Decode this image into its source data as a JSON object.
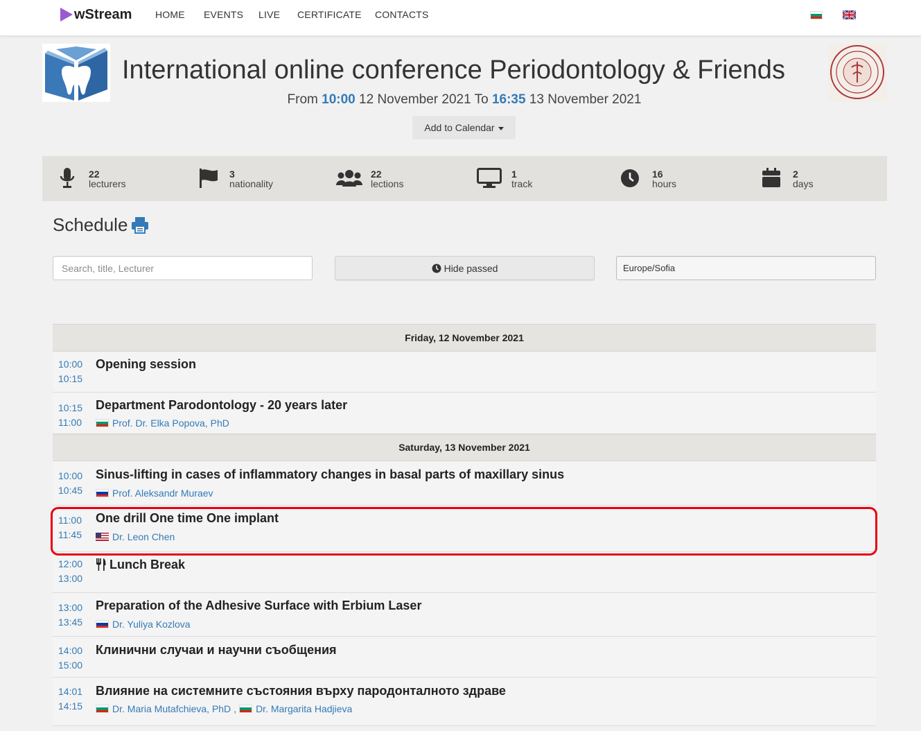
{
  "brand": "wStream",
  "nav": {
    "items": [
      "HOME",
      "EVENTS",
      "LIVE",
      "CERTIFICATE",
      "CONTACTS"
    ]
  },
  "header": {
    "title": "International online conference Periodontology & Friends",
    "from_label": "From",
    "from_time": "10:00",
    "from_date": "12 November 2021",
    "to_label": "To",
    "to_time": "16:35",
    "to_date": "13 November 2021",
    "add_to_calendar": "Add to Calendar"
  },
  "stats": [
    {
      "icon": "microphone-icon",
      "num": "22",
      "label": "lecturers"
    },
    {
      "icon": "flag-icon",
      "num": "3",
      "label": "nationality"
    },
    {
      "icon": "users-icon",
      "num": "22",
      "label": "lections"
    },
    {
      "icon": "monitor-icon",
      "num": "1",
      "label": "track"
    },
    {
      "icon": "clock-icon",
      "num": "16",
      "label": "hours"
    },
    {
      "icon": "calendar-icon",
      "num": "2",
      "label": "days"
    }
  ],
  "schedule": {
    "title": "Schedule",
    "search_placeholder": "Search, title, Lecturer",
    "hide_passed": "Hide passed",
    "timezone": "Europe/Sofia",
    "days": [
      {
        "label": "Friday, 12 November 2021",
        "events": [
          {
            "start": "10:00",
            "end": "10:15",
            "title": "Opening session",
            "speakers": []
          },
          {
            "start": "10:15",
            "end": "11:00",
            "title": "Department Parodontology - 20 years later",
            "speakers": [
              {
                "flag": "bg",
                "name": "Prof. Dr. Elka Popova, PhD"
              }
            ]
          }
        ]
      },
      {
        "label": "Saturday, 13 November 2021",
        "events": [
          {
            "start": "10:00",
            "end": "10:45",
            "title": "Sinus-lifting in cases of inflammatory changes in basal parts of maxillary sinus",
            "speakers": [
              {
                "flag": "ru",
                "name": "Prof. Aleksandr Muraev"
              }
            ]
          },
          {
            "start": "11:00",
            "end": "11:45",
            "title": "One drill One time One implant",
            "speakers": [
              {
                "flag": "us",
                "name": "Dr. Leon Chen"
              }
            ]
          },
          {
            "start": "12:00",
            "end": "13:00",
            "title": "Lunch Break",
            "icon": "cutlery-icon",
            "speakers": []
          },
          {
            "start": "13:00",
            "end": "13:45",
            "title": "Preparation of the Adhesive Surface with Erbium Laser",
            "speakers": [
              {
                "flag": "ru",
                "name": "Dr. Yuliya Kozlova"
              }
            ]
          },
          {
            "start": "14:00",
            "end": "15:00",
            "title": "Клинични случаи и научни съобщения",
            "speakers": []
          },
          {
            "start": "14:01",
            "end": "14:15",
            "title": "Влияние на системните състояния върху пародонталното здраве",
            "speakers": [
              {
                "flag": "bg",
                "name": "Dr. Maria Mutafchieva, PhD"
              },
              {
                "flag": "bg",
                "name": "Dr. Margarita Hadjieva"
              }
            ]
          }
        ]
      }
    ]
  },
  "colors": {
    "accent": "#337ab7",
    "brand": "#9b59d0",
    "highlight": "#e8000f"
  }
}
